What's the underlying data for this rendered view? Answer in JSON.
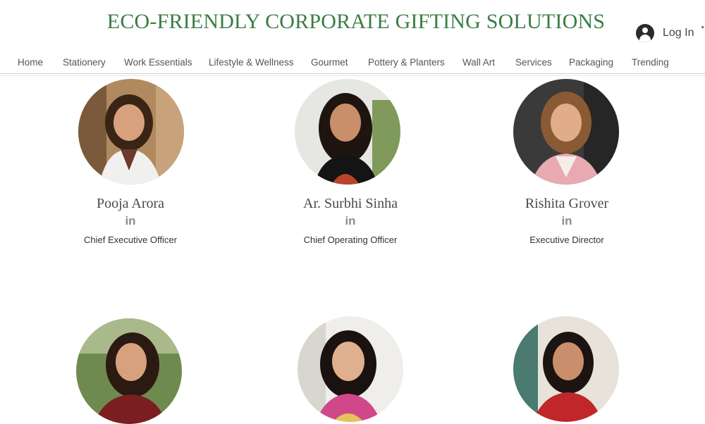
{
  "header": {
    "title": "ECO-FRIENDLY CORPORATE GIFTING SOLUTIONS",
    "login_label": "Log In"
  },
  "nav": {
    "items": [
      "Home",
      "Stationery",
      "Work Essentials",
      "Lifestyle & Wellness",
      "Gourmet",
      "Pottery & Planters",
      "Wall Art",
      "Services",
      "Packaging",
      "Trending"
    ]
  },
  "team": [
    {
      "name": "Pooja Arora",
      "social": "in",
      "role": "Chief Executive Officer"
    },
    {
      "name": "Ar. Surbhi Sinha",
      "social": "in",
      "role": "Chief Operating Officer"
    },
    {
      "name": "Rishita Grover",
      "social": "in",
      "role": "Executive Director"
    },
    {
      "name": "",
      "social": "",
      "role": ""
    },
    {
      "name": "",
      "social": "",
      "role": ""
    },
    {
      "name": "",
      "social": "",
      "role": ""
    }
  ],
  "colors": {
    "title": "#3a7d44",
    "nav_text": "#555555",
    "icon_grey": "#8c8c8c"
  }
}
